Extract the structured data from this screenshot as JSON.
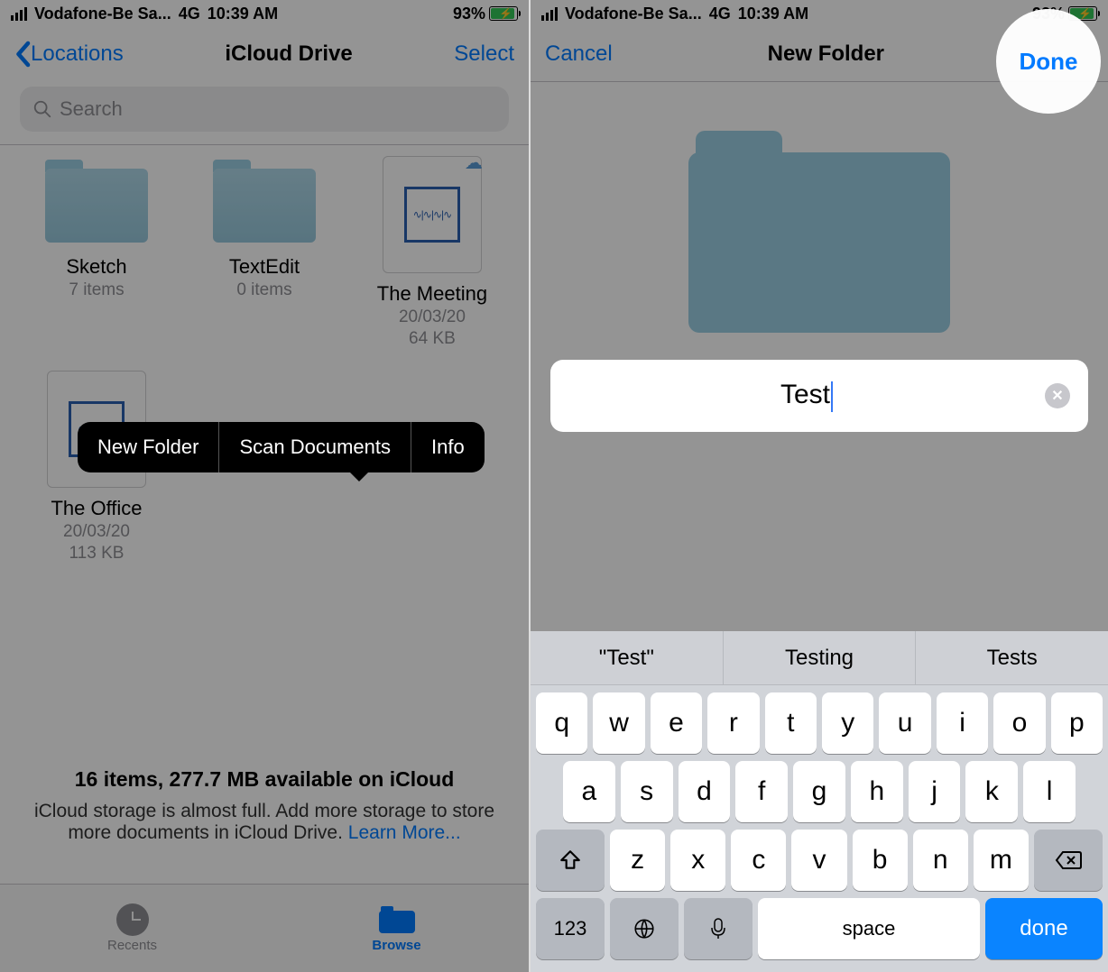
{
  "status": {
    "carrier": "Vodafone-Be Sa...",
    "network": "4G",
    "time": "10:39 AM",
    "battery_pct": "93%"
  },
  "left": {
    "nav_back": "Locations",
    "nav_title": "iCloud Drive",
    "nav_select": "Select",
    "search_placeholder": "Search",
    "items": [
      {
        "name": "Sketch",
        "sub1": "7 items",
        "sub2": "",
        "kind": "folder"
      },
      {
        "name": "TextEdit",
        "sub1": "0 items",
        "sub2": "",
        "kind": "folder"
      },
      {
        "name": "The Meeting",
        "sub1": "20/03/20",
        "sub2": "64 KB",
        "kind": "file",
        "cloud": true
      },
      {
        "name": "The Office",
        "sub1": "20/03/20",
        "sub2": "113 KB",
        "kind": "file"
      }
    ],
    "context_menu": {
      "new_folder": "New Folder",
      "scan": "Scan Documents",
      "info": "Info"
    },
    "footer_line1": "16 items, 277.7 MB available on iCloud",
    "footer_line2a": "iCloud storage is almost full. Add more storage to store more documents in iCloud Drive. ",
    "footer_link": "Learn More...",
    "tabs": {
      "recents": "Recents",
      "browse": "Browse"
    }
  },
  "right": {
    "nav_cancel": "Cancel",
    "nav_title": "New Folder",
    "nav_done": "Done",
    "folder_name": "Test",
    "suggestions": {
      "a": "\"Test\"",
      "b": "Testing",
      "c": "Tests"
    },
    "keys_row1": [
      "q",
      "w",
      "e",
      "r",
      "t",
      "y",
      "u",
      "i",
      "o",
      "p"
    ],
    "keys_row2": [
      "a",
      "s",
      "d",
      "f",
      "g",
      "h",
      "j",
      "k",
      "l"
    ],
    "keys_row3": [
      "z",
      "x",
      "c",
      "v",
      "b",
      "n",
      "m"
    ],
    "key_123": "123",
    "key_space": "space",
    "key_done": "done"
  }
}
